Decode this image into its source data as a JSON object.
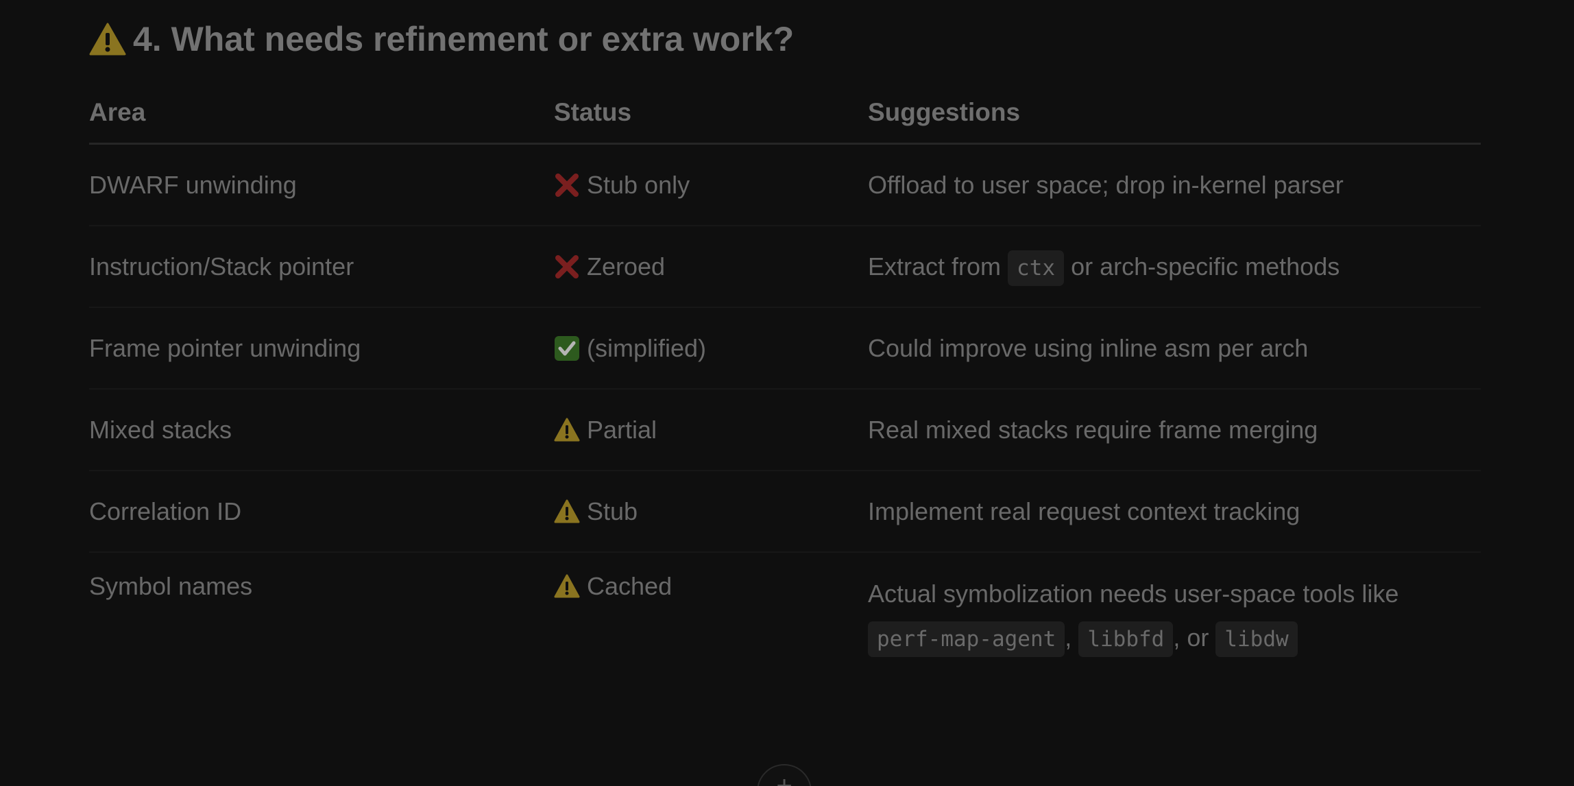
{
  "heading": {
    "icon": "warning-icon",
    "title": "4. What needs refinement or extra work?"
  },
  "table": {
    "headers": [
      "Area",
      "Status",
      "Suggestions"
    ],
    "rows": [
      {
        "area": "DWARF unwinding",
        "status_icon": "cross-icon",
        "status": "Stub only",
        "suggestion": "Offload to user space; drop in-kernel parser"
      },
      {
        "area": "Instruction/Stack pointer",
        "status_icon": "cross-icon",
        "status": "Zeroed",
        "suggestion_pre": "Extract from",
        "suggestion_code": "ctx",
        "suggestion_post": "or arch-specific methods"
      },
      {
        "area": "Frame pointer unwinding",
        "status_icon": "check-icon",
        "status": "(simplified)",
        "suggestion": "Could improve using inline asm per arch"
      },
      {
        "area": "Mixed stacks",
        "status_icon": "warning-icon",
        "status": "Partial",
        "suggestion": "Real mixed stacks require frame merging"
      },
      {
        "area": "Correlation ID",
        "status_icon": "warning-icon",
        "status": "Stub",
        "suggestion": "Implement real request context tracking"
      },
      {
        "area": "Symbol names",
        "status_icon": "warning-icon",
        "status": "Cached",
        "suggestion_text": "Actual symbolization needs user-space tools like",
        "suggestion_codes": [
          "perf-map-agent",
          "libbfd",
          "libdw"
        ],
        "sep1": ",",
        "sep2": ", or"
      }
    ]
  },
  "colors": {
    "background": "#0f0f0f",
    "warning": "#8a7420",
    "cross": "#7a1f1f",
    "check": "#2d5a1e"
  },
  "bottom_button_icon": "plus-icon"
}
